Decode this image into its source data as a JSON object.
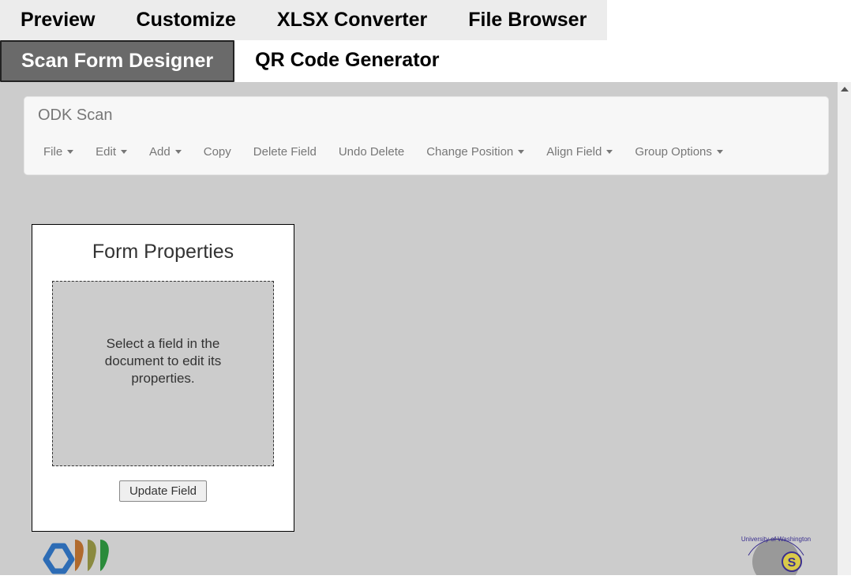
{
  "tabs_row1": [
    {
      "label": "Preview"
    },
    {
      "label": "Customize"
    },
    {
      "label": "XLSX Converter"
    },
    {
      "label": "File Browser"
    }
  ],
  "tabs_row2": [
    {
      "label": "Scan Form Designer",
      "active": true
    },
    {
      "label": "QR Code Generator",
      "active": false
    }
  ],
  "toolbar": {
    "title": "ODK Scan",
    "items": [
      {
        "label": "File",
        "caret": true
      },
      {
        "label": "Edit",
        "caret": true
      },
      {
        "label": "Add",
        "caret": true
      },
      {
        "label": "Copy",
        "caret": false
      },
      {
        "label": "Delete Field",
        "caret": false
      },
      {
        "label": "Undo Delete",
        "caret": false
      },
      {
        "label": "Change Position",
        "caret": true
      },
      {
        "label": "Align Field",
        "caret": true
      },
      {
        "label": "Group Options",
        "caret": true
      }
    ]
  },
  "properties": {
    "title": "Form Properties",
    "placeholder_text": "Select a field in the document to edit its properties.",
    "update_button": "Update Field"
  }
}
